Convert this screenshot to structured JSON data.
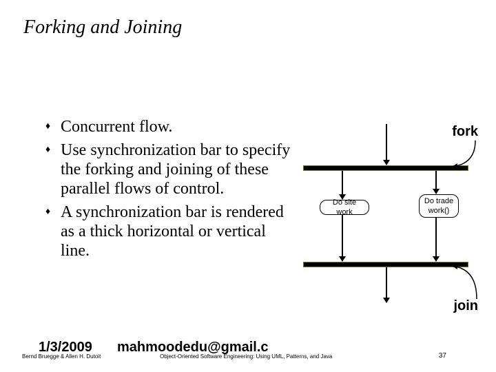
{
  "title": "Forking and Joining",
  "bullets": [
    "Concurrent flow.",
    "Use synchronization bar to specify the forking and joining of these parallel flows of control.",
    "A synchronization bar is rendered as a thick horizontal or vertical line."
  ],
  "diagram": {
    "fork_label": "fork",
    "join_label": "join",
    "activity_left": "Do site work",
    "activity_right": "Do trade work()"
  },
  "footer": {
    "date": "1/3/2009",
    "email": "mahmoodedu@gmail.c",
    "authors": "Bernd Bruegge & Allen H. Dutoit",
    "book": "Object-Oriented Software Engineering: Using UML, Patterns, and Java",
    "page": "37"
  }
}
